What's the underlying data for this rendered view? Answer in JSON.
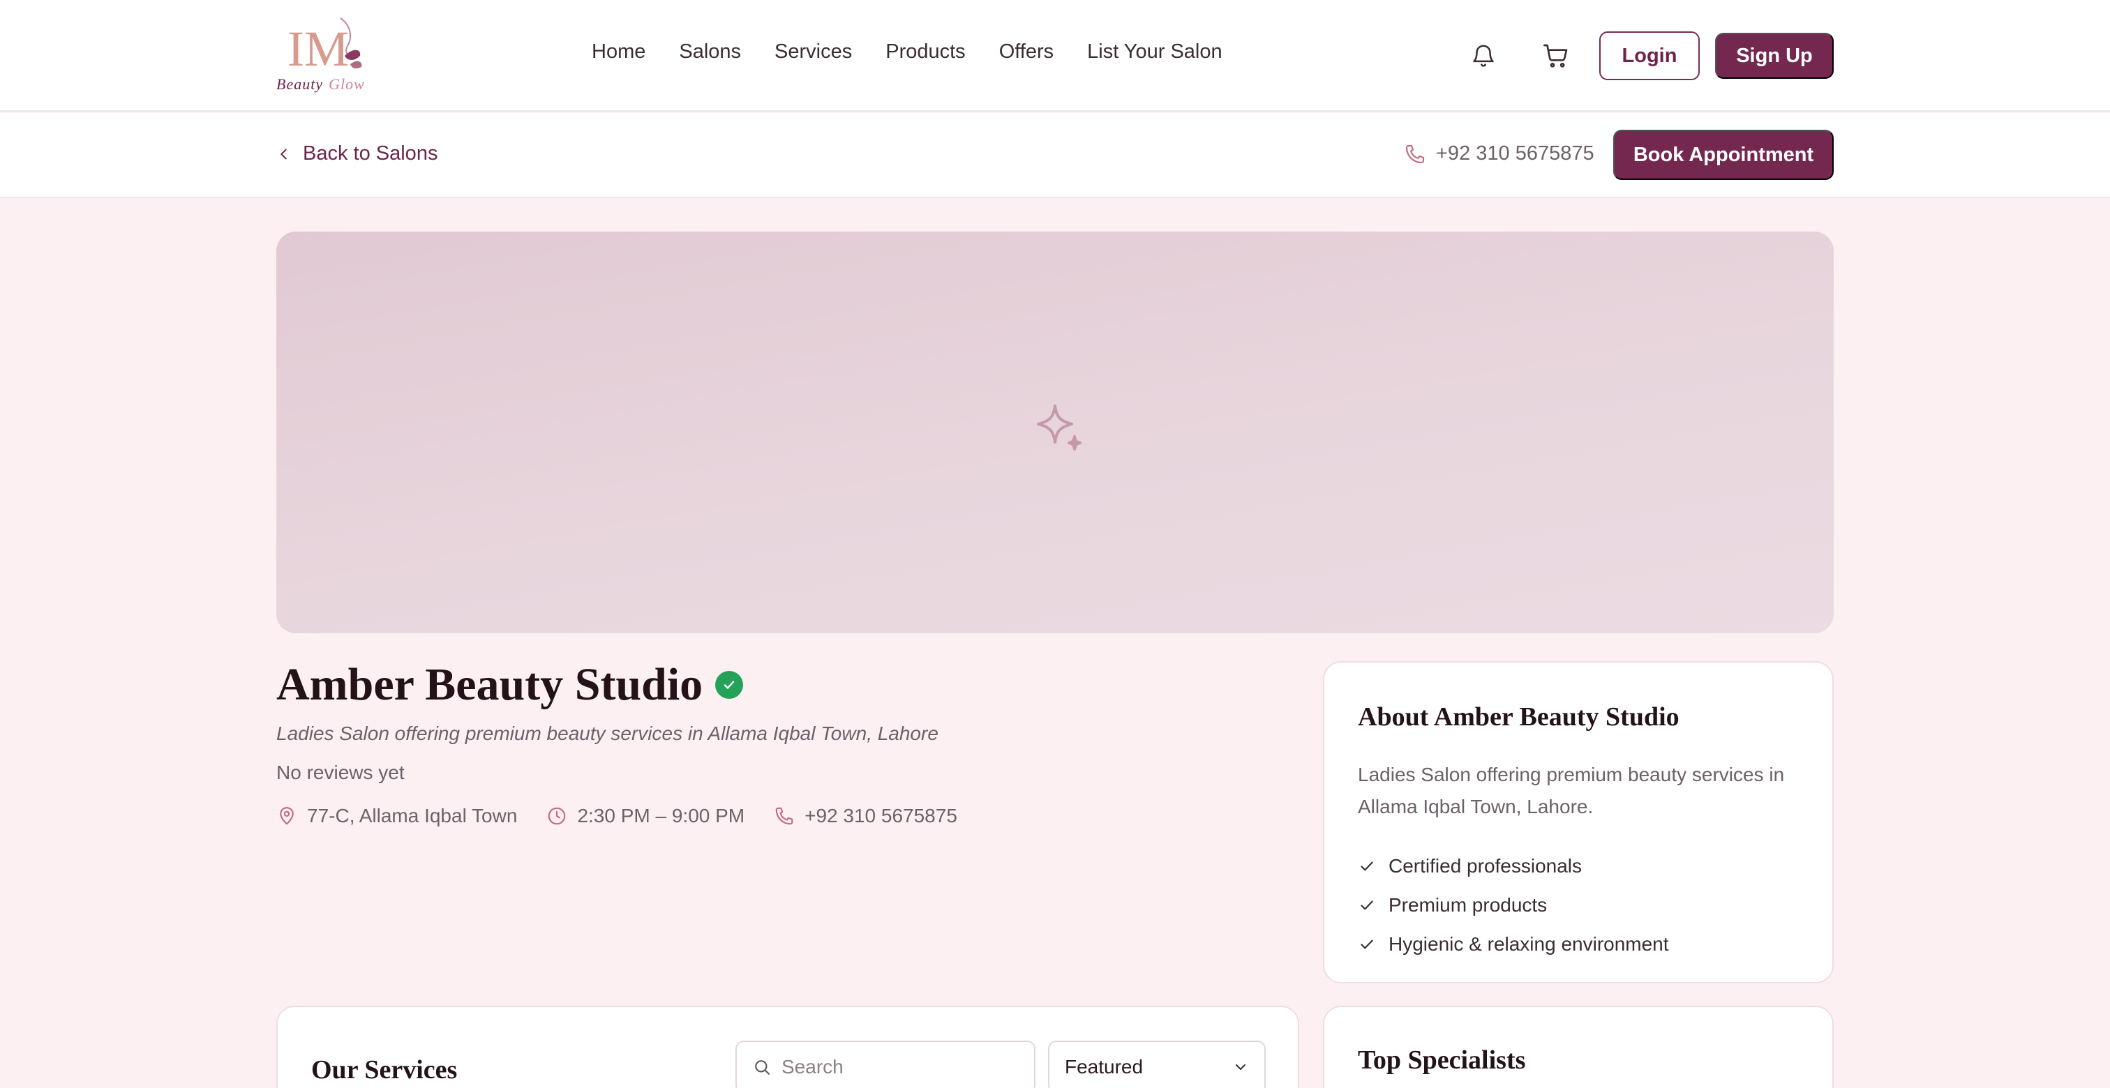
{
  "brand": {
    "logo_monogram": "IM",
    "logo_word1": "Beauty",
    "logo_word2": "Glow"
  },
  "nav": {
    "links": [
      "Home",
      "Salons",
      "Services",
      "Products",
      "Offers",
      "List Your Salon"
    ],
    "login_label": "Login",
    "signup_label": "Sign Up"
  },
  "subbar": {
    "back_label": "Back to Salons",
    "phone": "+92 310 5675875",
    "book_label": "Book Appointment"
  },
  "salon": {
    "name": "Amber Beauty Studio",
    "tagline": "Ladies Salon offering premium beauty services in Allama Iqbal Town, Lahore",
    "reviews": "No reviews yet",
    "address": "77-C, Allama Iqbal Town",
    "hours": "2:30 PM – 9:00 PM",
    "phone": "+92 310 5675875"
  },
  "about": {
    "title": "About Amber Beauty Studio",
    "description": "Ladies Salon offering premium beauty services in Allama Iqbal Town, Lahore.",
    "features": [
      "Certified professionals",
      "Premium products",
      "Hygienic & relaxing environment"
    ]
  },
  "services": {
    "title": "Our Services",
    "search_placeholder": "Search",
    "sort_selected": "Featured"
  },
  "specialists": {
    "title": "Top Specialists"
  },
  "colors": {
    "brand": "#742850",
    "page_bg": "#fdf0f3",
    "verified": "#25a25a",
    "accent_icon": "#c46a7e"
  },
  "icons": {
    "notification": "bell-icon",
    "cart": "cart-icon",
    "back": "chevron-left-icon",
    "phone": "phone-icon",
    "location": "map-pin-icon",
    "clock": "clock-icon",
    "check": "check-icon",
    "search": "search-icon",
    "dropdown": "chevron-down-icon",
    "hero_placeholder": "sparkles-icon",
    "verified": "verified-badge-icon"
  }
}
